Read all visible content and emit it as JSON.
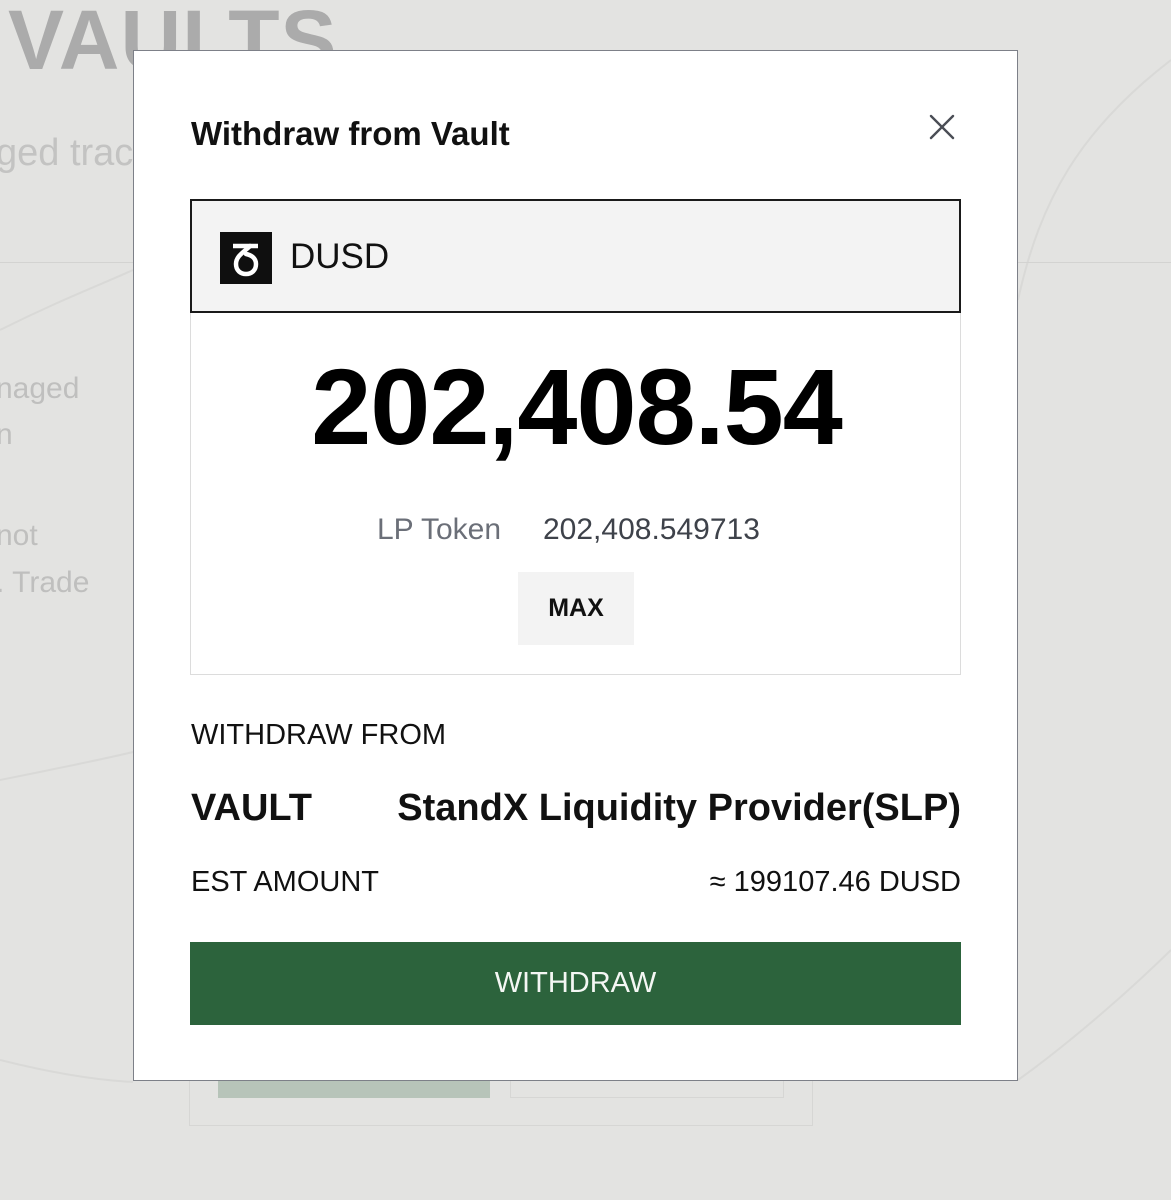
{
  "background": {
    "title": "VAULTS",
    "subtitle": "ged trac",
    "lines": [
      "naged",
      "n",
      "not",
      ". Trade"
    ]
  },
  "modal": {
    "title": "Withdraw from Vault",
    "close_icon": "close-icon",
    "token": {
      "logo_icon": "delta-logo-icon",
      "name": "DUSD"
    },
    "amount": "202,408.54",
    "lp_token": {
      "label": "LP Token",
      "value": "202,408.549713"
    },
    "max_label": "MAX",
    "withdraw_from_label": "WITHDRAW FROM",
    "vault_label": "VAULT",
    "vault_name": "StandX Liquidity Provider(SLP)",
    "est_amount_label": "EST AMOUNT",
    "est_amount_value": "≈ 199107.46 DUSD",
    "withdraw_button_label": "WITHDRAW"
  },
  "colors": {
    "primary_button": "#2c633c",
    "overlay_background": "#e3e3e1",
    "token_logo": "#0f0f0f"
  }
}
